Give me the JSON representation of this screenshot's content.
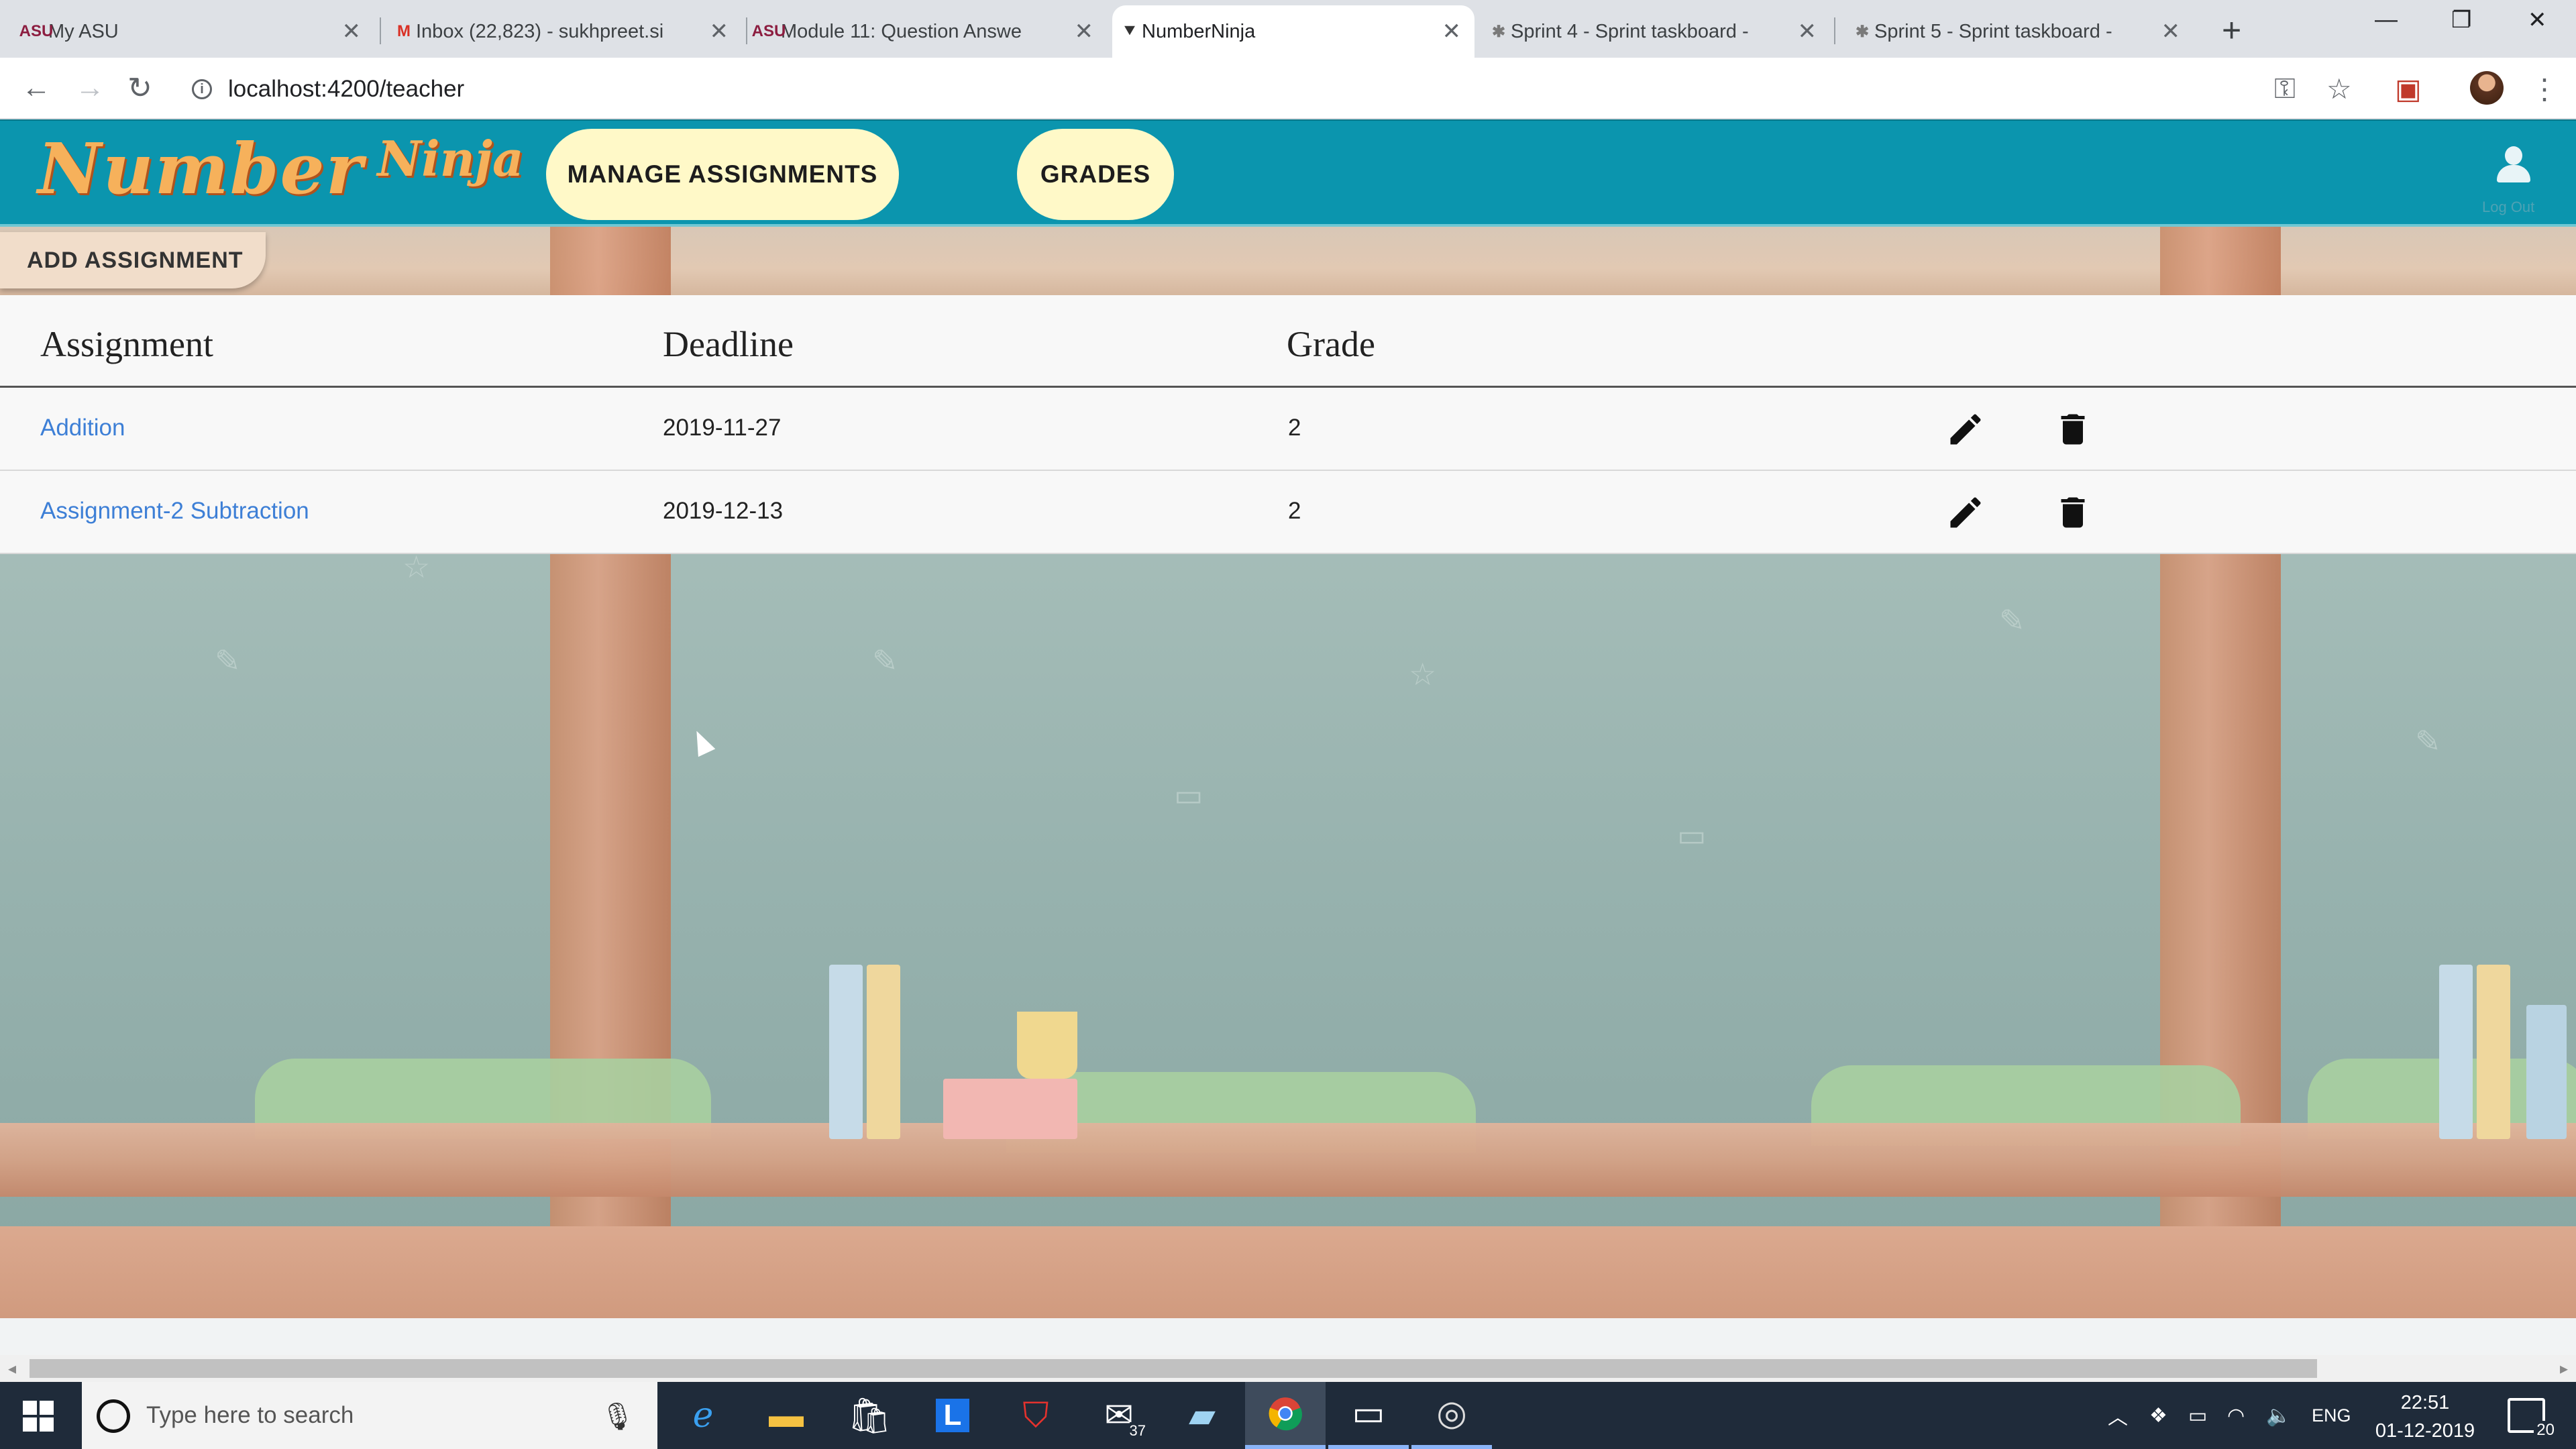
{
  "browser": {
    "tabs": [
      {
        "label": "My ASU",
        "favicon": "asu-icon"
      },
      {
        "label": "Inbox (22,823) - sukhpreet.si",
        "favicon": "gmail-icon"
      },
      {
        "label": "Module 11: Question Answe",
        "favicon": "asu-icon"
      },
      {
        "label": "NumberNinja",
        "favicon": "numberninja-icon",
        "active": true
      },
      {
        "label": "Sprint 4 - Sprint taskboard -",
        "favicon": "taskboard-icon"
      },
      {
        "label": "Sprint 5 - Sprint taskboard -",
        "favicon": "taskboard-icon"
      }
    ],
    "url": "localhost:4200/teacher"
  },
  "app": {
    "logo_main": "Number",
    "logo_accent": "Ninja",
    "nav": {
      "manage": "MANAGE ASSIGNMENTS",
      "grades": "GRADES"
    },
    "logout_label": "Log Out",
    "add_assignment": "ADD ASSIGNMENT",
    "brand_color": "#0b95ae",
    "pill_color": "#fff9c8"
  },
  "table": {
    "headers": {
      "assignment": "Assignment",
      "deadline": "Deadline",
      "grade": "Grade"
    },
    "rows": [
      {
        "assignment": "Addition",
        "deadline": "2019-11-27",
        "grade": "2"
      },
      {
        "assignment": "Assignment-2 Subtraction",
        "deadline": "2019-12-13",
        "grade": "2"
      }
    ],
    "link_color": "#3d7fd6"
  },
  "taskbar": {
    "search_placeholder": "Type here to search",
    "mail_badge": "37",
    "language": "ENG",
    "time": "22:51",
    "date": "01-12-2019",
    "notifications": "20"
  }
}
